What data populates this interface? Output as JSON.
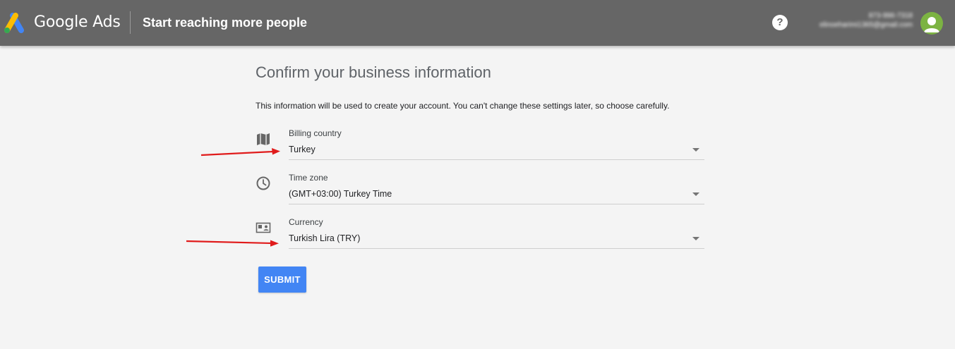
{
  "header": {
    "brand": "Google Ads",
    "page_heading": "Start reaching more people",
    "help_icon": "help-icon",
    "account_id": "873-996-7318",
    "account_email": "elinoeharimi1365@gmail.com"
  },
  "main": {
    "title": "Confirm your business information",
    "description": "This information will be used to create your account. You can't change these settings later, so choose carefully.",
    "fields": [
      {
        "label": "Billing country",
        "value": "Turkey",
        "icon": "map-icon"
      },
      {
        "label": "Time zone",
        "value": "(GMT+03:00) Turkey Time",
        "icon": "clock-icon"
      },
      {
        "label": "Currency",
        "value": "Turkish Lira (TRY)",
        "icon": "currency-card-icon"
      }
    ],
    "submit_label": "SUBMIT"
  },
  "colors": {
    "topbar": "#666666",
    "accent": "#4285f4",
    "annotation_arrow": "#e01b1b"
  }
}
